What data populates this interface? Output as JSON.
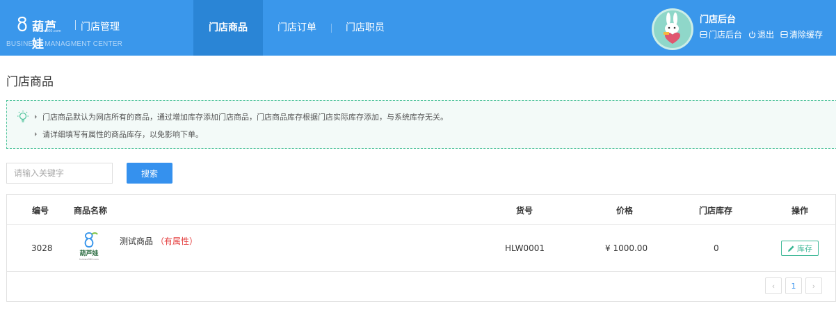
{
  "header": {
    "logo_text": "葫芦娃",
    "logo_url": "hulowa360.com",
    "title": "门店管理",
    "subtitle": "BUSINESS MANAGMENT CENTER",
    "nav": [
      {
        "label": "门店商品"
      },
      {
        "label": "门店订单"
      },
      {
        "label": "门店职员"
      }
    ],
    "user": {
      "title": "门店后台",
      "links": [
        {
          "label": "门店后台",
          "icon": "backend-icon"
        },
        {
          "label": "退出",
          "icon": "power-icon"
        },
        {
          "label": "清除缓存",
          "icon": "clear-cache-icon"
        }
      ]
    }
  },
  "page": {
    "title": "门店商品",
    "tips": [
      "门店商品默认为网店所有的商品，通过增加库存添加门店商品，门店商品库存根据门店实际库存添加，与系统库存无关。",
      "请详细填写有属性的商品库存，以免影响下单。"
    ]
  },
  "search": {
    "placeholder": "请输入关键字",
    "button": "搜索"
  },
  "table": {
    "columns": [
      "编号",
      "商品名称",
      "货号",
      "价格",
      "门店库存",
      "操作"
    ],
    "rows": [
      {
        "id": "3028",
        "name": "测试商品",
        "tag": "（有属性）",
        "sku": "HLW0001",
        "price": "¥ 1000.00",
        "stock": "0",
        "action": "库存"
      }
    ]
  },
  "pagination": {
    "prev": "‹",
    "current": "1",
    "next": "›"
  },
  "colors": {
    "header_bg": "#3a97eb",
    "nav_active_bg": "#2a85d6",
    "tip_border": "#51c49c",
    "primary_button": "#3591ee",
    "tag_red": "#e43d3d",
    "stock_green": "#3ab795"
  }
}
